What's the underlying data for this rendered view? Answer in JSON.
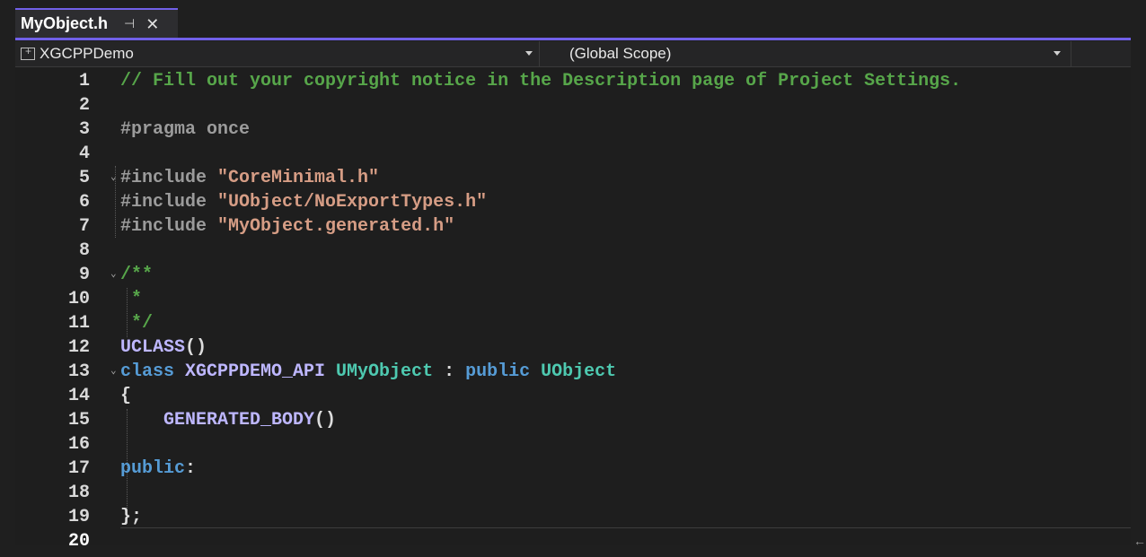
{
  "tab": {
    "title": "MyObject.h",
    "pin_glyph": "⊣",
    "close_glyph": "✕"
  },
  "navbar": {
    "project": "XGCPPDemo",
    "scope": "(Global Scope)"
  },
  "colors": {
    "accent": "#7160e8",
    "comment": "#57a64a",
    "keyword": "#569cd6",
    "string": "#d69d85",
    "type": "#4ec9b0",
    "macro": "#beb7ff",
    "preprocessor": "#9b9b9b"
  },
  "editor": {
    "current_line": "20",
    "lines": [
      {
        "num": "1",
        "segments": [
          {
            "t": "// Fill out your copyright notice in the Description page of Project Settings.",
            "c": "comment"
          }
        ]
      },
      {
        "num": "2",
        "segments": []
      },
      {
        "num": "3",
        "segments": [
          {
            "t": "#pragma once",
            "c": "pre"
          }
        ]
      },
      {
        "num": "4",
        "segments": []
      },
      {
        "num": "5",
        "fold": "⌄",
        "segments": [
          {
            "t": "#include ",
            "c": "pre"
          },
          {
            "t": "\"CoreMinimal.h\"",
            "c": "str"
          }
        ]
      },
      {
        "num": "6",
        "segments": [
          {
            "t": "#include ",
            "c": "pre"
          },
          {
            "t": "\"UObject/NoExportTypes.h\"",
            "c": "str"
          }
        ]
      },
      {
        "num": "7",
        "segments": [
          {
            "t": "#include ",
            "c": "pre"
          },
          {
            "t": "\"MyObject.generated.h\"",
            "c": "str"
          }
        ]
      },
      {
        "num": "8",
        "segments": []
      },
      {
        "num": "9",
        "fold": "⌄",
        "segments": [
          {
            "t": "/**",
            "c": "comment"
          }
        ]
      },
      {
        "num": "10",
        "segments": [
          {
            "t": " *",
            "c": "comment"
          }
        ]
      },
      {
        "num": "11",
        "segments": [
          {
            "t": " */",
            "c": "comment"
          }
        ]
      },
      {
        "num": "12",
        "segments": [
          {
            "t": "UCLASS",
            "c": "macro"
          },
          {
            "t": "()",
            "c": "plain"
          }
        ]
      },
      {
        "num": "13",
        "fold": "⌄",
        "segments": [
          {
            "t": "class ",
            "c": "kw"
          },
          {
            "t": "XGCPPDEMO_API ",
            "c": "macro"
          },
          {
            "t": "UMyObject",
            "c": "type"
          },
          {
            "t": " : ",
            "c": "plain"
          },
          {
            "t": "public ",
            "c": "kw"
          },
          {
            "t": "UObject",
            "c": "type"
          }
        ]
      },
      {
        "num": "14",
        "segments": [
          {
            "t": "{",
            "c": "plain"
          }
        ]
      },
      {
        "num": "15",
        "segments": [
          {
            "t": "    GENERATED_BODY",
            "c": "macro"
          },
          {
            "t": "()",
            "c": "plain"
          }
        ]
      },
      {
        "num": "16",
        "segments": []
      },
      {
        "num": "17",
        "segments": [
          {
            "t": "public",
            "c": "kw"
          },
          {
            "t": ":",
            "c": "plain"
          }
        ]
      },
      {
        "num": "18",
        "segments": []
      },
      {
        "num": "19",
        "segments": [
          {
            "t": "};",
            "c": "plain"
          }
        ]
      },
      {
        "num": "20",
        "segments": []
      }
    ]
  }
}
